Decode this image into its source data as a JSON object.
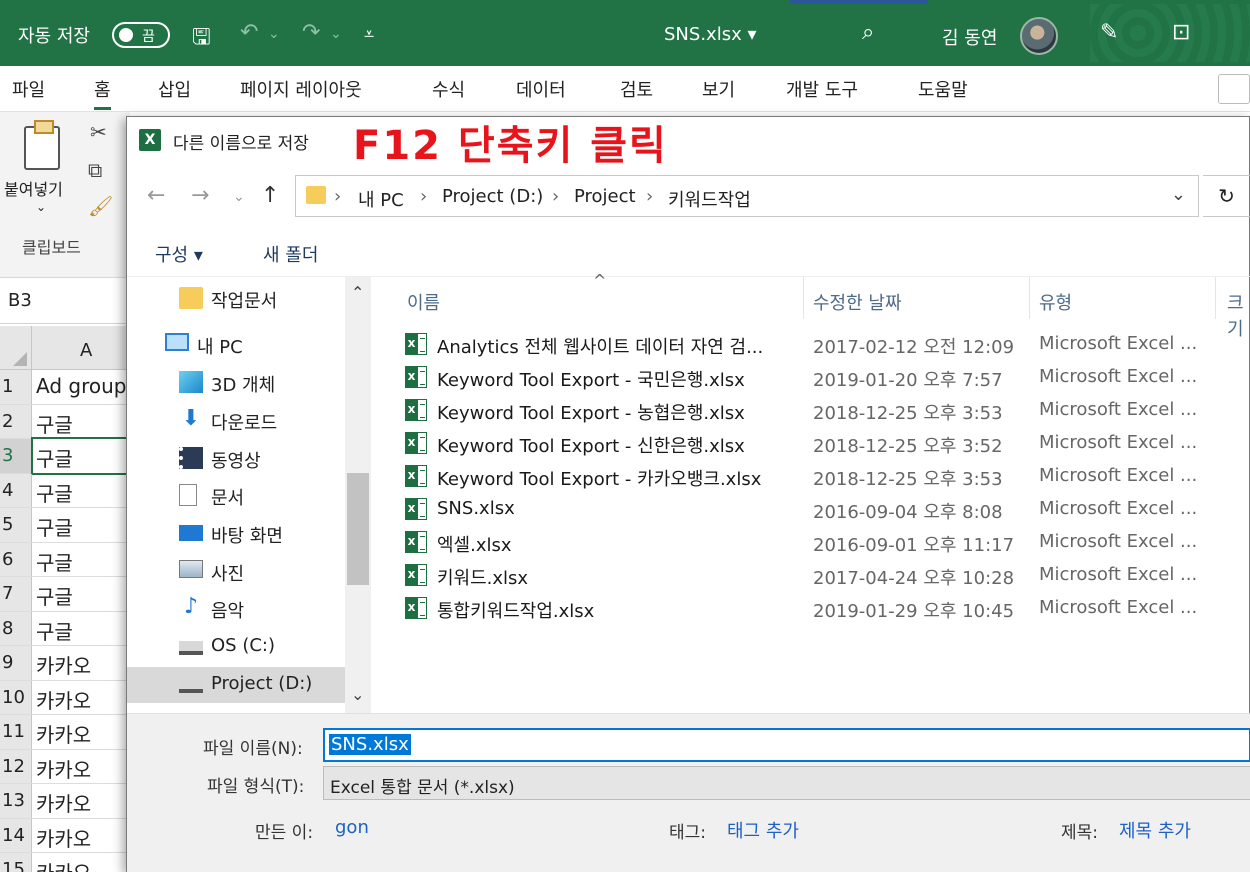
{
  "excel": {
    "autosave_label": "자동 저장",
    "autosave_state": "끔",
    "file_title": "SNS.xlsx",
    "user_name": "김 동연",
    "tabs": [
      "파일",
      "홈",
      "삽입",
      "페이지 레이아웃",
      "수식",
      "데이터",
      "검토",
      "보기",
      "개발 도구",
      "도움말"
    ],
    "active_tab": "홈",
    "paste_label": "붙여넣기",
    "clipboard_group": "클립보드",
    "name_box": "B3",
    "column_a": "A",
    "rows": [
      {
        "num": "1",
        "value": "Ad group"
      },
      {
        "num": "2",
        "value": "구글"
      },
      {
        "num": "3",
        "value": "구글"
      },
      {
        "num": "4",
        "value": "구글"
      },
      {
        "num": "5",
        "value": "구글"
      },
      {
        "num": "6",
        "value": "구글"
      },
      {
        "num": "7",
        "value": "구글"
      },
      {
        "num": "8",
        "value": "구글"
      },
      {
        "num": "9",
        "value": "카카오"
      },
      {
        "num": "10",
        "value": "카카오"
      },
      {
        "num": "11",
        "value": "카카오"
      },
      {
        "num": "12",
        "value": "카카오"
      },
      {
        "num": "13",
        "value": "카카오"
      },
      {
        "num": "14",
        "value": "카카오"
      },
      {
        "num": "15",
        "value": "카카오"
      }
    ]
  },
  "dialog": {
    "title": "다른 이름으로 저장",
    "annotation": "F12 단축키 클릭",
    "breadcrumb": [
      "내 PC",
      "Project (D:)",
      "Project",
      "키워드작업"
    ],
    "toolbar": {
      "organize": "구성 ▾",
      "new_folder": "새 폴더"
    },
    "nav_items": [
      {
        "label": "작업문서",
        "icon": "folder-icon"
      },
      {
        "label": "내 PC",
        "icon": "computer-icon"
      },
      {
        "label": "3D 개체",
        "icon": "cube-icon"
      },
      {
        "label": "다운로드",
        "icon": "download-icon"
      },
      {
        "label": "동영상",
        "icon": "video-icon"
      },
      {
        "label": "문서",
        "icon": "document-icon"
      },
      {
        "label": "바탕 화면",
        "icon": "desktop-icon"
      },
      {
        "label": "사진",
        "icon": "picture-icon"
      },
      {
        "label": "음악",
        "icon": "music-icon"
      },
      {
        "label": "OS (C:)",
        "icon": "drive-icon"
      },
      {
        "label": "Project (D:)",
        "icon": "drive-icon"
      }
    ],
    "columns": {
      "name": "이름",
      "date": "수정한 날짜",
      "type": "유형",
      "size": "크기"
    },
    "files": [
      {
        "name": "Analytics 전체 웹사이트 데이터 자연 검...",
        "date": "2017-02-12 오전 12:09",
        "type": "Microsoft Excel ..."
      },
      {
        "name": "Keyword Tool Export - 국민은행.xlsx",
        "date": "2019-01-20 오후 7:57",
        "type": "Microsoft Excel ..."
      },
      {
        "name": "Keyword Tool Export - 농협은행.xlsx",
        "date": "2018-12-25 오후 3:53",
        "type": "Microsoft Excel ..."
      },
      {
        "name": "Keyword Tool Export - 신한은행.xlsx",
        "date": "2018-12-25 오후 3:52",
        "type": "Microsoft Excel ..."
      },
      {
        "name": "Keyword Tool Export - 카카오뱅크.xlsx",
        "date": "2018-12-25 오후 3:53",
        "type": "Microsoft Excel ..."
      },
      {
        "name": "SNS.xlsx",
        "date": "2016-09-04 오후 8:08",
        "type": "Microsoft Excel ..."
      },
      {
        "name": "엑셀.xlsx",
        "date": "2016-09-01 오후 11:17",
        "type": "Microsoft Excel ..."
      },
      {
        "name": "키워드.xlsx",
        "date": "2017-04-24 오후 10:28",
        "type": "Microsoft Excel ..."
      },
      {
        "name": "통합키워드작업.xlsx",
        "date": "2019-01-29 오후 10:45",
        "type": "Microsoft Excel ..."
      }
    ],
    "filename_label": "파일 이름(N):",
    "filename_value": "SNS.xlsx",
    "filetype_label": "파일 형식(T):",
    "filetype_value": "Excel 통합 문서 (*.xlsx)",
    "author_label": "만든 이:",
    "author_value": "gon",
    "tags_label": "태그:",
    "tags_value": "태그 추가",
    "title_label": "제목:",
    "title_value": "제목 추가"
  }
}
